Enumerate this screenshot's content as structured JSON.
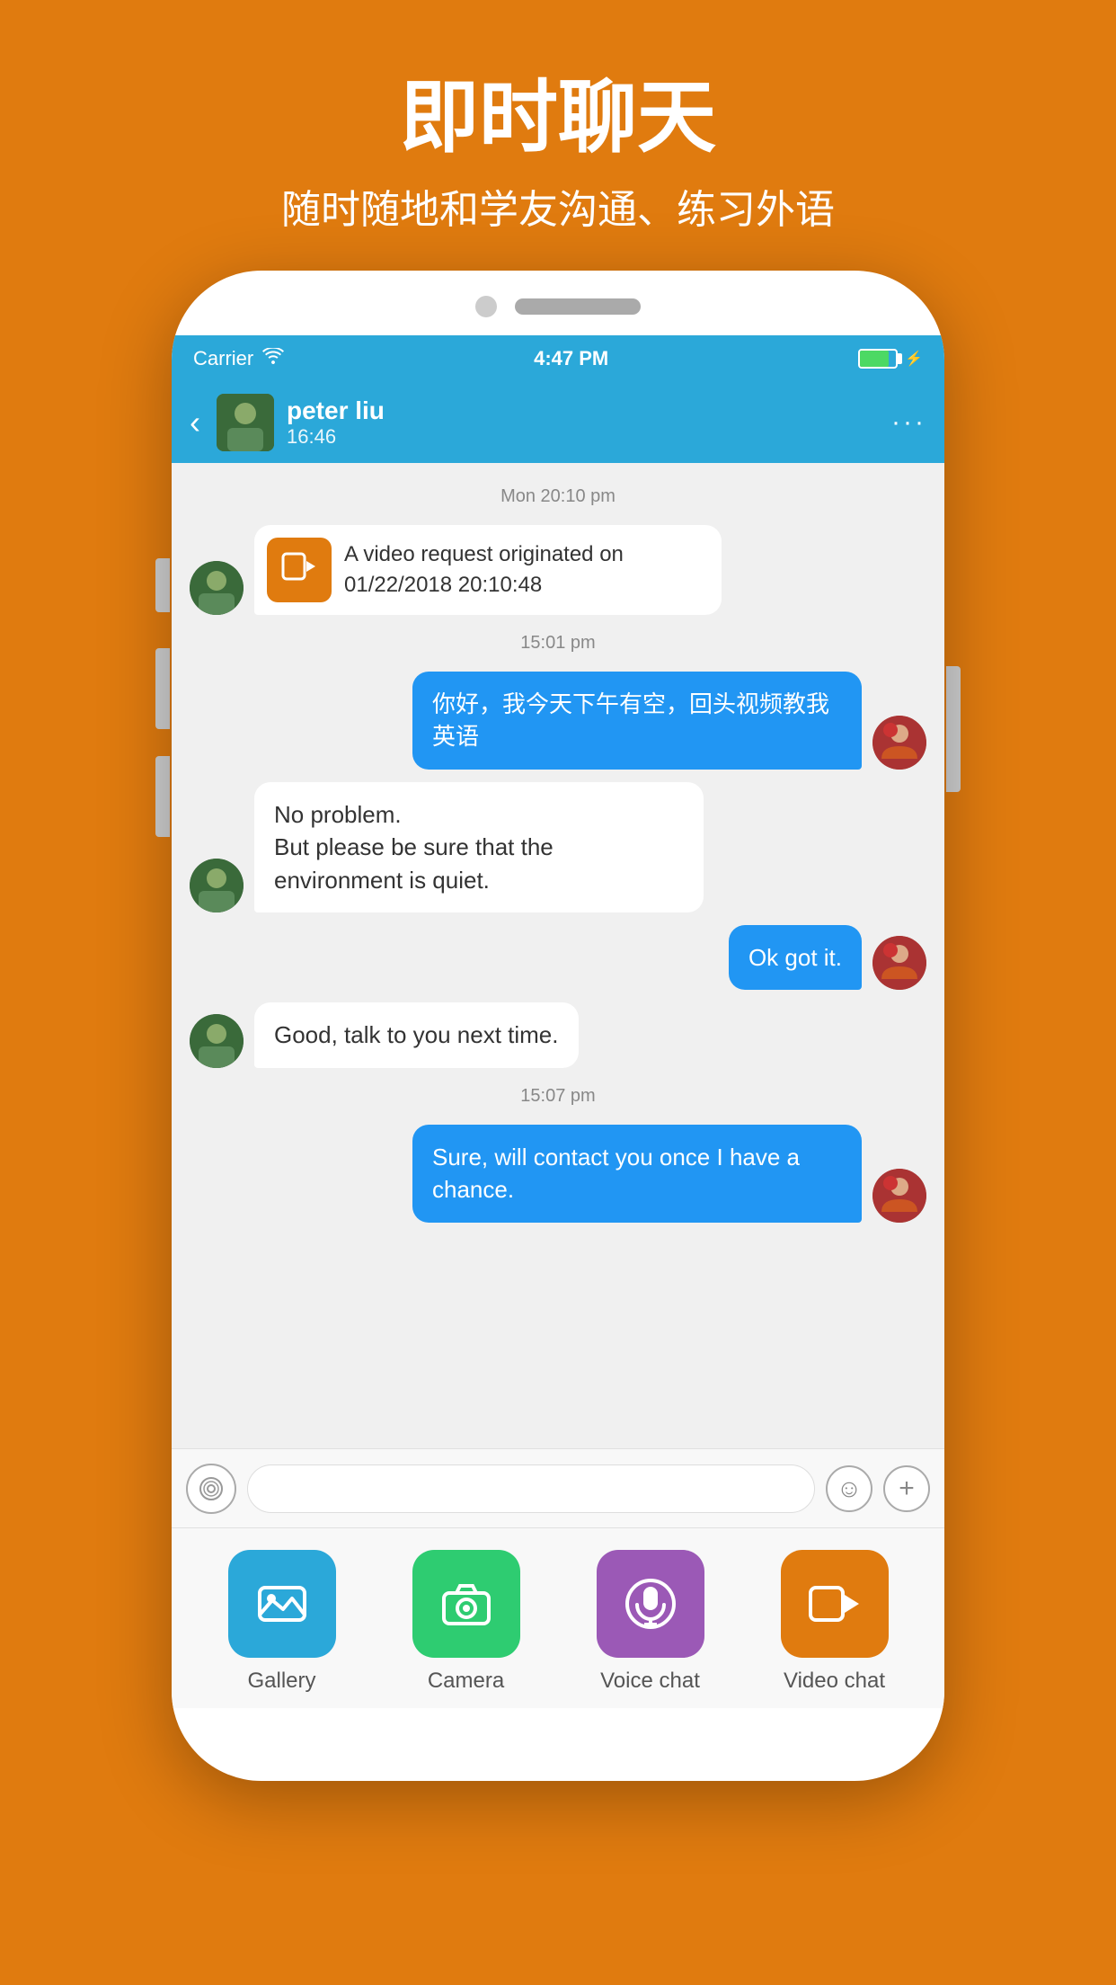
{
  "header": {
    "title": "即时聊天",
    "subtitle": "随时随地和学友沟通、练习外语"
  },
  "status_bar": {
    "carrier": "Carrier",
    "time": "4:47 PM",
    "battery_pct": 80
  },
  "nav": {
    "contact_name": "peter liu",
    "contact_time": "16:46",
    "back_icon": "‹",
    "more_icon": "···"
  },
  "chat": {
    "messages": [
      {
        "type": "timestamp",
        "text": "Mon 20:10 pm"
      },
      {
        "type": "received",
        "kind": "video_request",
        "text": "A video request originated on 01/22/2018 20:10:48",
        "avatar": "1"
      },
      {
        "type": "timestamp",
        "text": "15:01 pm"
      },
      {
        "type": "sent",
        "text": "你好，我今天下午有空，回头视频教我英语",
        "avatar": "2"
      },
      {
        "type": "received",
        "text": "No  problem.\nBut  please be sure that the environment is  quiet.",
        "avatar": "1"
      },
      {
        "type": "sent",
        "text": "Ok got it.",
        "avatar": "2"
      },
      {
        "type": "received",
        "text": "Good, talk  to you next time.",
        "avatar": "1"
      },
      {
        "type": "timestamp",
        "text": "15:07 pm"
      },
      {
        "type": "sent",
        "text": "Sure, will contact you once I have a chance.",
        "avatar": "2"
      }
    ]
  },
  "input": {
    "placeholder": "",
    "voice_icon": "◎",
    "emoji_icon": "☺",
    "plus_icon": "+"
  },
  "toolbar": {
    "items": [
      {
        "label": "Gallery",
        "type": "gallery",
        "icon": "🖼"
      },
      {
        "label": "Camera",
        "type": "camera",
        "icon": "📷"
      },
      {
        "label": "Voice chat",
        "type": "voice",
        "icon": "🎙"
      },
      {
        "label": "Video chat",
        "type": "video",
        "icon": "▶"
      }
    ]
  }
}
